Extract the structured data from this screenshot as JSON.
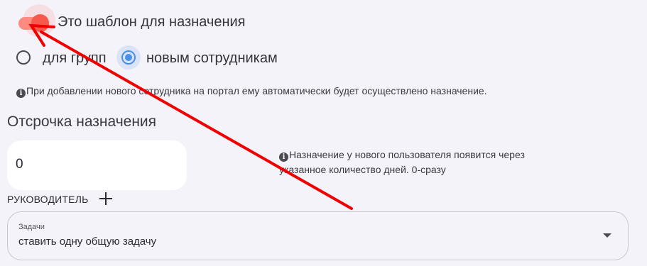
{
  "template_toggle": {
    "label": "Это шаблон для назначения",
    "checked": true
  },
  "assign_to": {
    "options": [
      {
        "label": "для групп",
        "checked": false
      },
      {
        "label": "новым сотрудникам",
        "checked": true
      }
    ]
  },
  "portal_info": {
    "text": "При добавлении нового сотрудника на портал ему автоматически будет осуществлено назначение."
  },
  "delay": {
    "title": "Отсрочка назначения",
    "value": "0",
    "hint_line1": "Назначение у нового пользователя появится через",
    "hint_line2": "указанное количество дней. 0-сразу"
  },
  "manager": {
    "label": "РУКОВОДИТЕЛЬ"
  },
  "tasks_select": {
    "caption": "Задачи",
    "value": "ставить одну общую задачу"
  },
  "colors": {
    "accent_red": "#f65a4d",
    "radio_blue": "#4a8fe8",
    "annotation_red": "#f20000"
  },
  "icons": [
    "info-icon",
    "plus-icon",
    "chevron-down-icon"
  ]
}
